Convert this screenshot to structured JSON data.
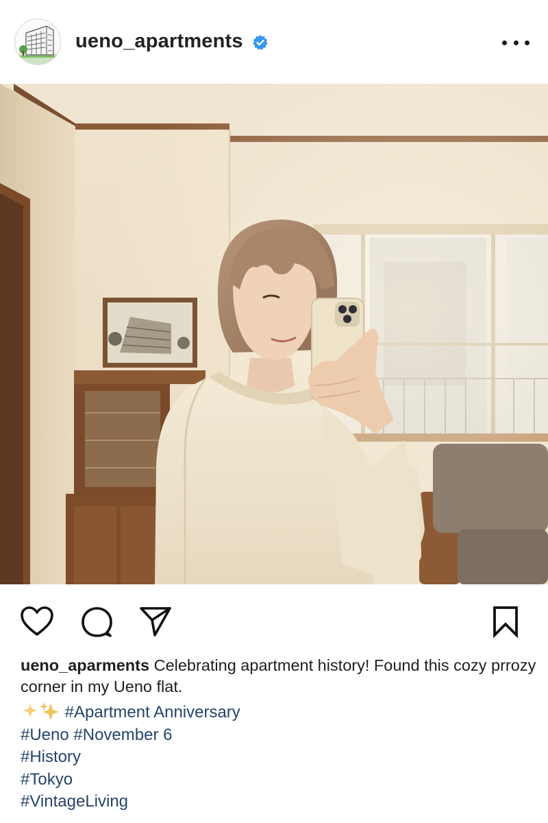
{
  "post": {
    "username": "ueno_apartments",
    "verified": true
  },
  "actions": {
    "like": "heart-icon",
    "comment": "comment-icon",
    "share": "send-icon",
    "save": "bookmark-icon"
  },
  "caption": {
    "username": "ueno_aparments",
    "text": " Celebrating apartment history! Found this cozy prrozy corner in my Ueno flat.",
    "tag_apartment": "#Apartment Anniversary",
    "tag_ueno": "#Ueno",
    "tag_november": "#November 6",
    "tag_history": "#History",
    "tag_tokyo": "#Tokyo",
    "tag_vintage": "#VintageLiving"
  },
  "colors": {
    "verified": "#3897f0",
    "hashtag": "#24456b",
    "sparkle": "#f0c060"
  }
}
